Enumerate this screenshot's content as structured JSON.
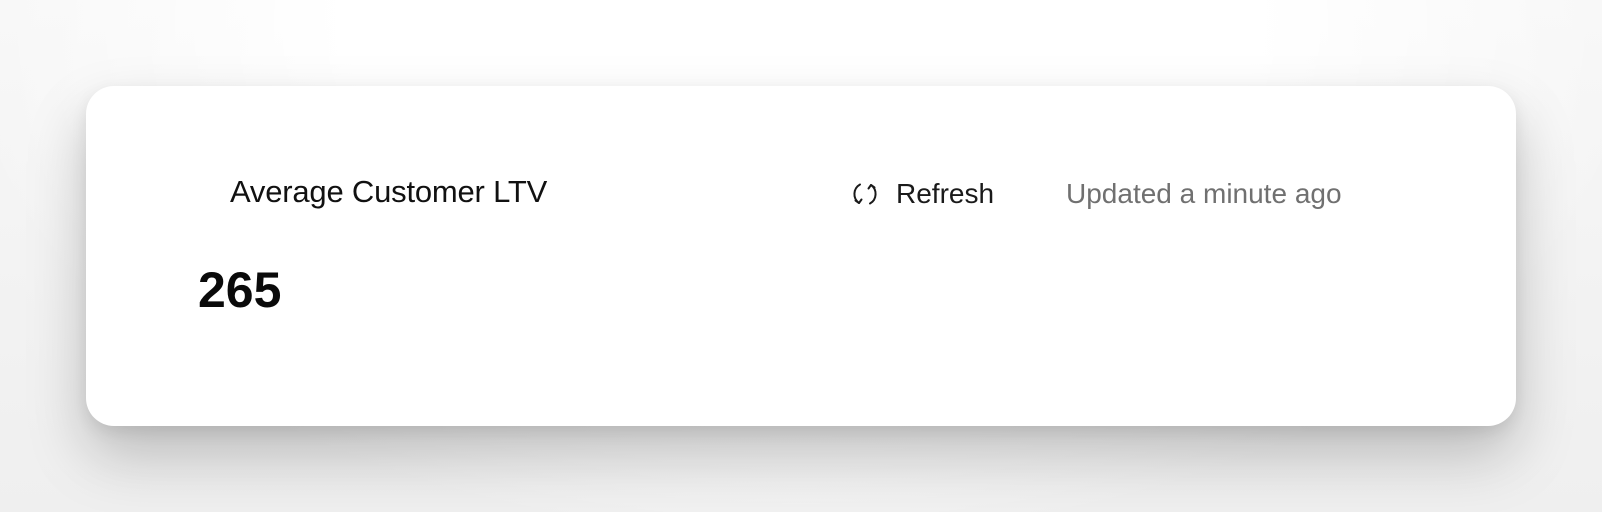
{
  "card": {
    "title": "Average Customer LTV",
    "value": "265"
  },
  "toolbar": {
    "refresh_label": "Refresh",
    "refresh_icon": "refresh-icon",
    "updated_text": "Updated a minute ago"
  }
}
